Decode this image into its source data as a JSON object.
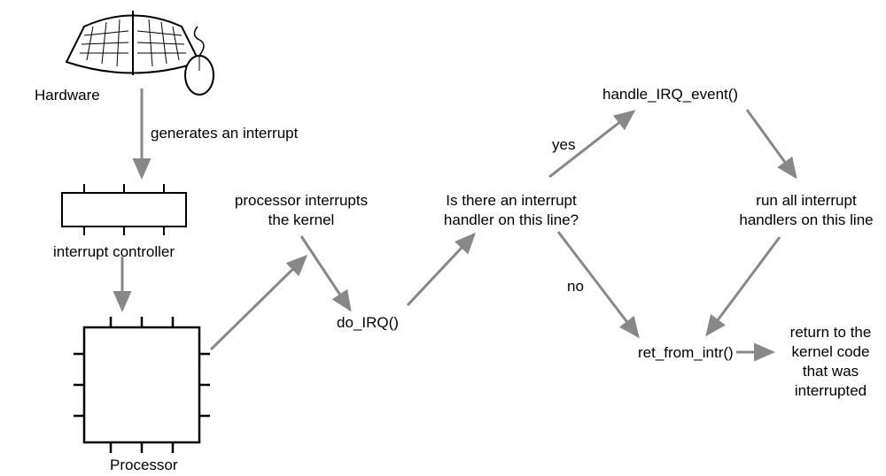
{
  "hardware_label": "Hardware",
  "interrupt_controller_label": "interrupt controller",
  "processor_label": "Processor",
  "generates_label": "generates an interrupt",
  "processor_interrupts_label": "processor interrupts\nthe kernel",
  "do_irq_label": "do_IRQ()",
  "question_label": "Is there an interrupt\nhandler on this line?",
  "yes_label": "yes",
  "no_label": "no",
  "handle_irq_event_label": "handle_IRQ_event()",
  "run_handlers_label": "run all interrupt\nhandlers on this line",
  "ret_from_intr_label": "ret_from_intr()",
  "return_label": "return to  the\nkernel code\nthat was\ninterrupted"
}
